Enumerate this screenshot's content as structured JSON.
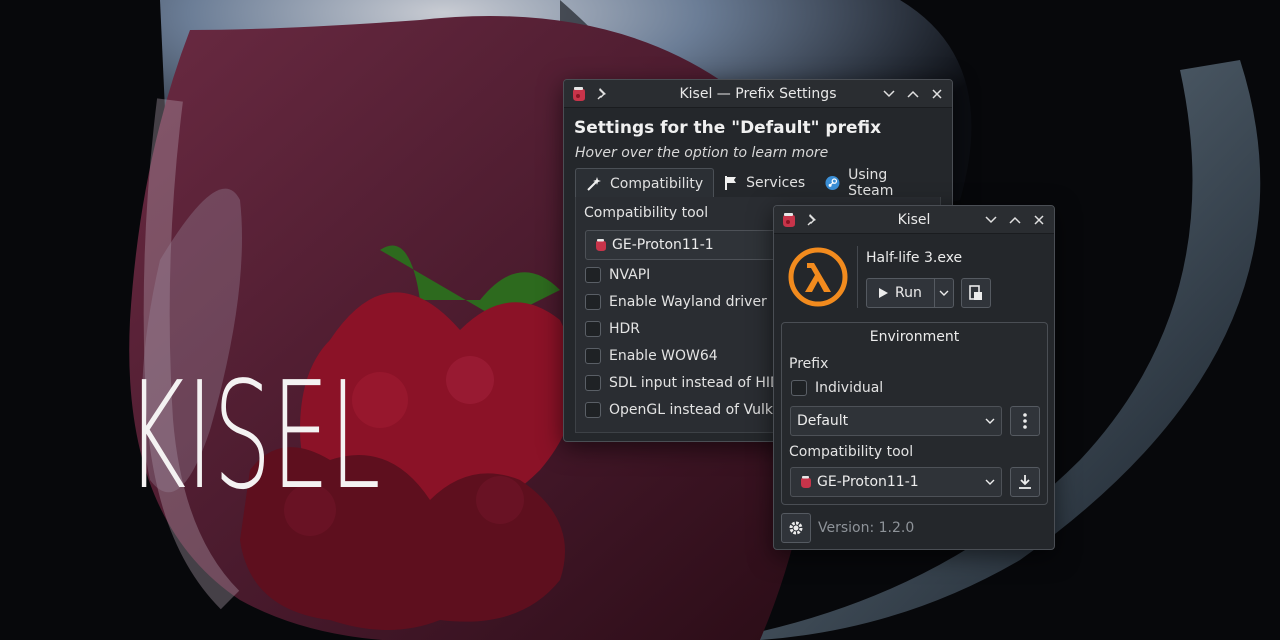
{
  "brand": {
    "logo_text": "KISEL"
  },
  "colors": {
    "accent_orange": "#f28b1e",
    "berry_red": "#8b1e2c",
    "window_bg": "#24272b"
  },
  "prefix_window": {
    "title": "Kisel — Prefix Settings",
    "heading": "Settings for the \"Default\" prefix",
    "subtitle": "Hover over the option to learn more",
    "tabs": [
      {
        "label": "Compatibility",
        "icon": "magic-wand-icon",
        "active": true
      },
      {
        "label": "Services",
        "icon": "flag-icon",
        "active": false
      },
      {
        "label": "Using Steam",
        "icon": "steam-icon",
        "active": false
      }
    ],
    "compat_label": "Compatibility tool",
    "compat_value": "GE-Proton11-1",
    "options": [
      {
        "label": "NVAPI",
        "checked": false
      },
      {
        "label": "Enable Wayland driver",
        "checked": false
      },
      {
        "label": "HDR",
        "checked": false
      },
      {
        "label": "Enable WOW64",
        "checked": false
      },
      {
        "label": "SDL input instead of HID",
        "checked": false
      },
      {
        "label": "OpenGL instead of Vulkan",
        "checked": false
      }
    ]
  },
  "main_window": {
    "title": "Kisel",
    "exe_name": "Half-life 3.exe",
    "run_label": "Run",
    "environment": {
      "title": "Environment",
      "prefix_label": "Prefix",
      "individual_label": "Individual",
      "individual_checked": false,
      "prefix_value": "Default",
      "compat_label": "Compatibility tool",
      "compat_value": "GE-Proton11-1"
    },
    "version": "Version: 1.2.0"
  }
}
